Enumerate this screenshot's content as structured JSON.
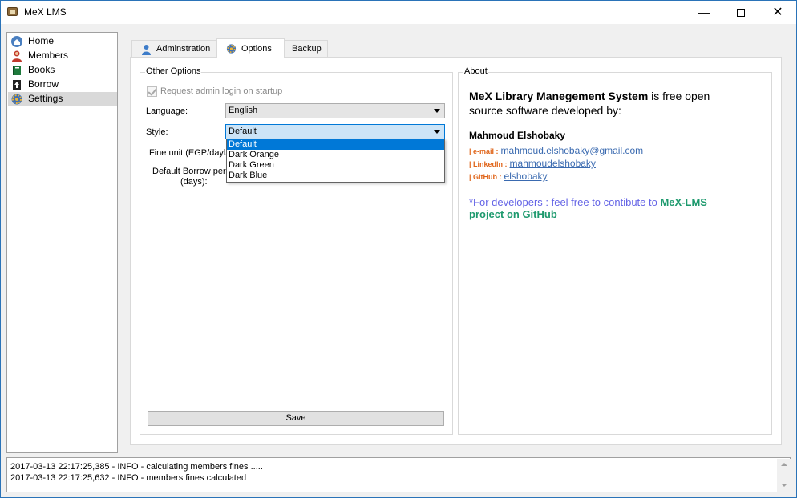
{
  "window": {
    "title": "MeX LMS",
    "minimize_glyph": "—",
    "close_glyph": "✕"
  },
  "nav": {
    "items": [
      {
        "label": "Home",
        "icon": "home-icon",
        "selected": false
      },
      {
        "label": "Members",
        "icon": "members-icon",
        "selected": false
      },
      {
        "label": "Books",
        "icon": "books-icon",
        "selected": false
      },
      {
        "label": "Borrow",
        "icon": "borrow-icon",
        "selected": false
      },
      {
        "label": "Settings",
        "icon": "gear-icon",
        "selected": true
      }
    ]
  },
  "tabs": [
    {
      "label": "Adminstration",
      "icon": "user-icon",
      "active": false
    },
    {
      "label": "Options",
      "icon": "gear-icon",
      "active": true
    },
    {
      "label": "Backup",
      "icon": "",
      "active": false
    }
  ],
  "other_options": {
    "title": "Other Options",
    "request_admin_login": {
      "label": "Request admin login on startup",
      "checked": true,
      "enabled": false
    },
    "language": {
      "label": "Language:",
      "value": "English"
    },
    "style": {
      "label": "Style:",
      "value": "Default",
      "options": [
        "Default",
        "Dark Orange",
        "Dark Green",
        "Dark Blue"
      ],
      "selected_index": 0,
      "expanded": true
    },
    "fine_unit": {
      "label": "Fine unit (EGP/dayla"
    },
    "borrow_period": {
      "label_line1": "Default Borrow per",
      "label_line2": "(days):"
    },
    "save_label": "Save"
  },
  "about": {
    "title": "About",
    "system_name": "MeX Library Manegement System",
    "desc_rest": " is free open",
    "desc_line2": "source software developed by:",
    "author": "Mahmoud Elshobaky",
    "contacts": [
      {
        "tag": "| e-mail :",
        "value": "mahmoud.elshobaky@gmail.com"
      },
      {
        "tag": "| LinkedIn :",
        "value": "mahmoudelshobaky"
      },
      {
        "tag": "| GitHub :",
        "value": "elshobaky"
      }
    ],
    "dev_text": "*For developers : feel free to contibute to ",
    "dev_link1": "MeX-LMS",
    "dev_link2": "project on GitHub"
  },
  "log": {
    "lines": [
      "2017-03-13 22:17:25,385 - INFO - calculating members fines .....",
      "2017-03-13 22:17:25,632 - INFO - members fines calculated"
    ]
  },
  "colors": {
    "accent": "#0078d7",
    "contact_tag": "#e0651a",
    "link": "#3a6ab0",
    "dev_text": "#6464e6",
    "dev_link": "#1e9a6e"
  }
}
